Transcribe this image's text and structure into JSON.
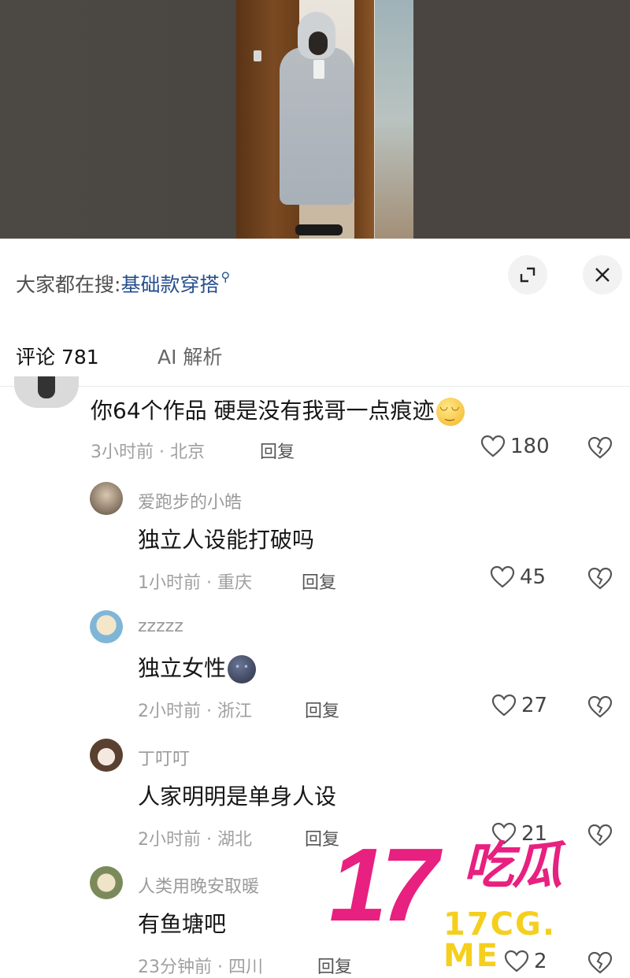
{
  "search": {
    "prefix": "大家都在搜:",
    "term": "基础款穿搭",
    "search_glyph": "⚲"
  },
  "tabs": [
    {
      "label": "评论 781",
      "active": true
    },
    {
      "label": "AI 解析",
      "active": false
    }
  ],
  "comments": [
    {
      "text": "你64个作品 硬是没有我哥一点痕迹",
      "emoji": "smiling-face",
      "time_location": "3小时前 · 北京",
      "reply_label": "回复",
      "likes": "180"
    },
    {
      "username": "爱跑步的小皓",
      "text": "独立人设能打破吗",
      "time_location": "1小时前 · 重庆",
      "reply_label": "回复",
      "likes": "45"
    },
    {
      "username": "zzzzz",
      "text": "独立女性",
      "emoji": "dark-face",
      "time_location": "2小时前 · 浙江",
      "reply_label": "回复",
      "likes": "27"
    },
    {
      "username": "丁叮叮",
      "text": "人家明明是单身人设",
      "time_location": "2小时前 · 湖北",
      "reply_label": "回复",
      "likes": "21"
    },
    {
      "username": "人类用晚安取暖",
      "text": "有鱼塘吧",
      "time_location": "23分钟前 · 四川",
      "reply_label": "回复",
      "likes": "2"
    }
  ],
  "watermark": {
    "number": "17",
    "name": "吃瓜",
    "url": "17CG. ME"
  },
  "colors": {
    "search_term": "#27508f",
    "watermark_pink": "#e8207f",
    "watermark_yellow": "#f5cf1e"
  }
}
